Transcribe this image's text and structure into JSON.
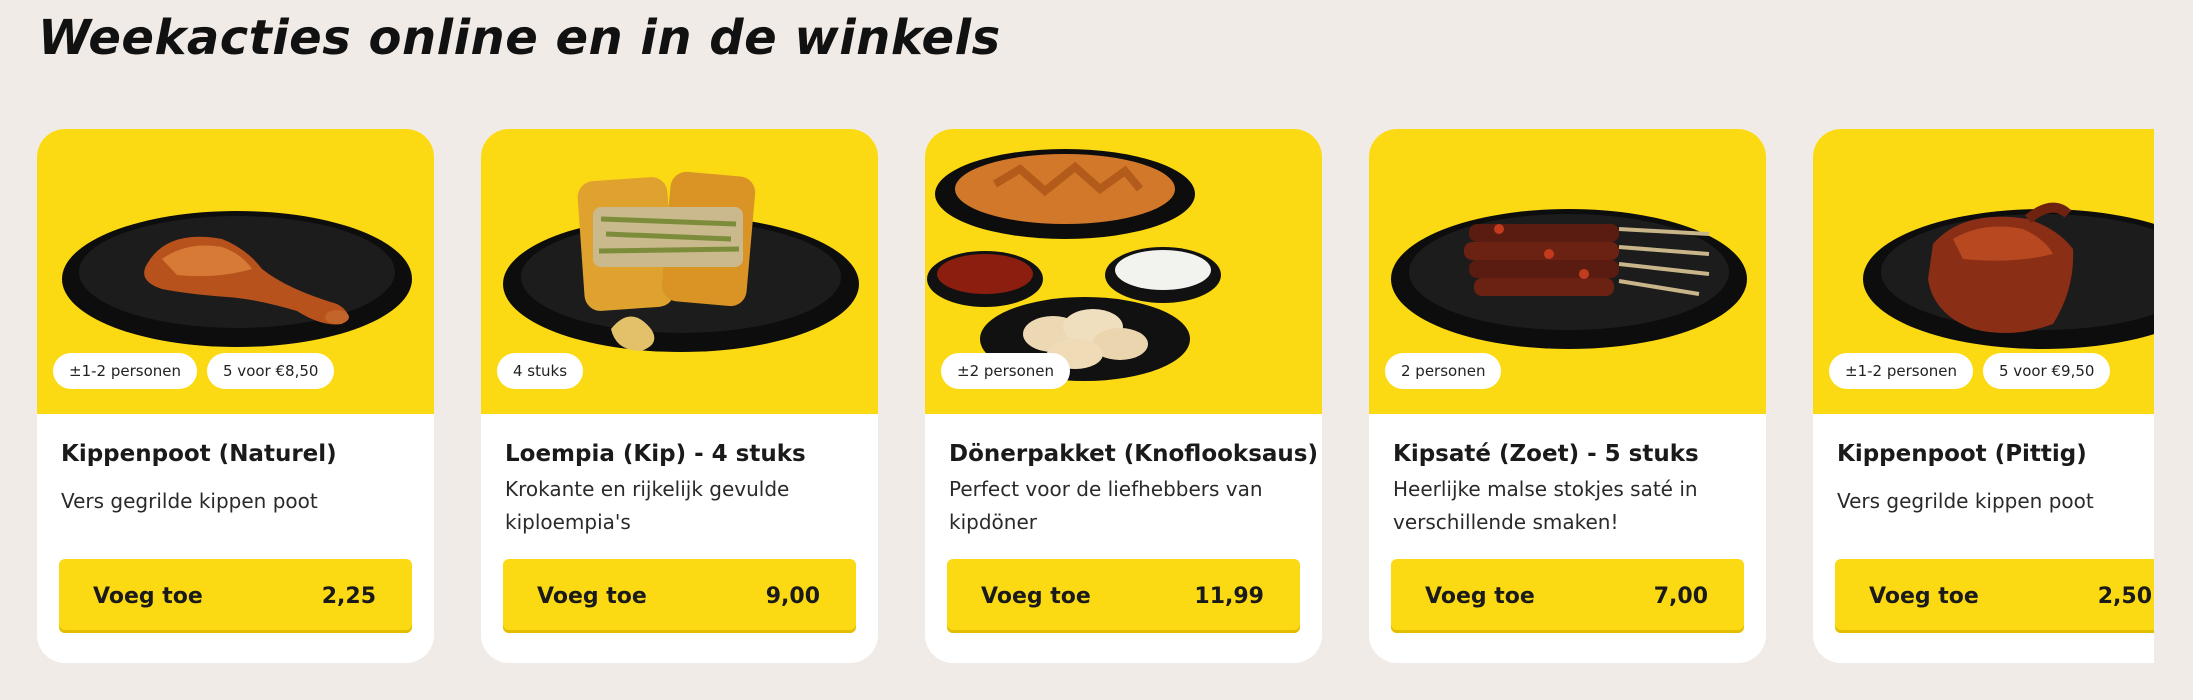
{
  "section_title": "Weekacties online en in de winkels",
  "colors": {
    "brand_yellow": "#fbd913",
    "background": "#f1ebe7",
    "card": "#ffffff"
  },
  "products": [
    {
      "name": "Kippenpoot (Naturel)",
      "description": "Vers gegrilde kippen poot",
      "badges": [
        "±1-2 personen",
        "5 voor €8,50"
      ],
      "button_label": "Voeg toe",
      "price": "2,25",
      "image": "chicken-leg-plate-icon"
    },
    {
      "name": "Loempia (Kip) - 4 stuks",
      "description": "Krokante en rijkelijk gevulde kiploempia's",
      "badges": [
        "4 stuks"
      ],
      "button_label": "Voeg toe",
      "price": "9,00",
      "image": "spring-roll-plate-icon"
    },
    {
      "name": "Dönerpakket (Knoflooksaus)",
      "description": "Perfect voor de liefhebbers van kipdöner",
      "badges": [
        "±2 personen"
      ],
      "button_label": "Voeg toe",
      "price": "11,99",
      "image": "doner-package-icon"
    },
    {
      "name": "Kipsaté (Zoet) - 5 stuks",
      "description": "Heerlijke malse stokjes saté in verschillende smaken!",
      "badges": [
        "2 personen"
      ],
      "button_label": "Voeg toe",
      "price": "7,00",
      "image": "satay-skewers-plate-icon"
    },
    {
      "name": "Kippenpoot (Pittig)",
      "description": "Vers gegrilde kippen poot",
      "badges": [
        "±1-2 personen",
        "5 voor €9,50"
      ],
      "button_label": "Voeg toe",
      "price": "2,50",
      "image": "spicy-chicken-leg-plate-icon"
    }
  ]
}
